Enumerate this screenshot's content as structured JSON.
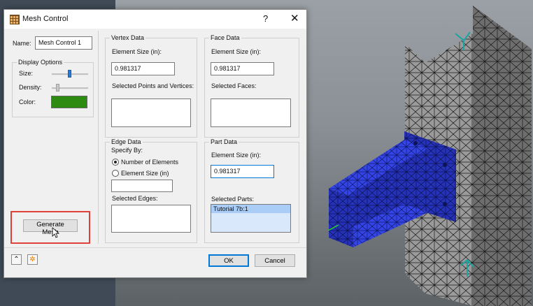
{
  "dialog": {
    "title": "Mesh Control",
    "help_glyph": "?",
    "close_glyph": "✕"
  },
  "left": {
    "name_label": "Name:",
    "name_value": "Mesh Control 1",
    "display_options_title": "Display Options",
    "size_label": "Size:",
    "density_label": "Density:",
    "color_label": "Color:",
    "color_value": "#2e8b12",
    "generate_mesh_label": "Generate Mesh"
  },
  "vertex": {
    "title": "Vertex Data",
    "element_size_label": "Element Size (in):",
    "element_size_value": "0.981317",
    "selected_label": "Selected Points and Vertices:"
  },
  "face": {
    "title": "Face Data",
    "element_size_label": "Element Size (in):",
    "element_size_value": "0.981317",
    "selected_label": "Selected Faces:"
  },
  "edge": {
    "title": "Edge Data",
    "specify_by_label": "Specify By:",
    "option_number": "Number of Elements",
    "option_size": "Element Size (in)",
    "selected_option": "Number of Elements",
    "selected_label": "Selected Edges:"
  },
  "part": {
    "title": "Part Data",
    "element_size_label": "Element Size (in):",
    "element_size_value": "0.981317",
    "selected_label": "Selected Parts:",
    "parts": [
      "Tutorial 7b:1"
    ]
  },
  "footer": {
    "ok_label": "OK",
    "cancel_label": "Cancel",
    "collapse_icon": "⌃",
    "options_icon": "✲"
  },
  "colors": {
    "highlight_box": "#e0413a",
    "mesh_blue": "#2f3fe0",
    "selection": "#a9cdf7"
  }
}
